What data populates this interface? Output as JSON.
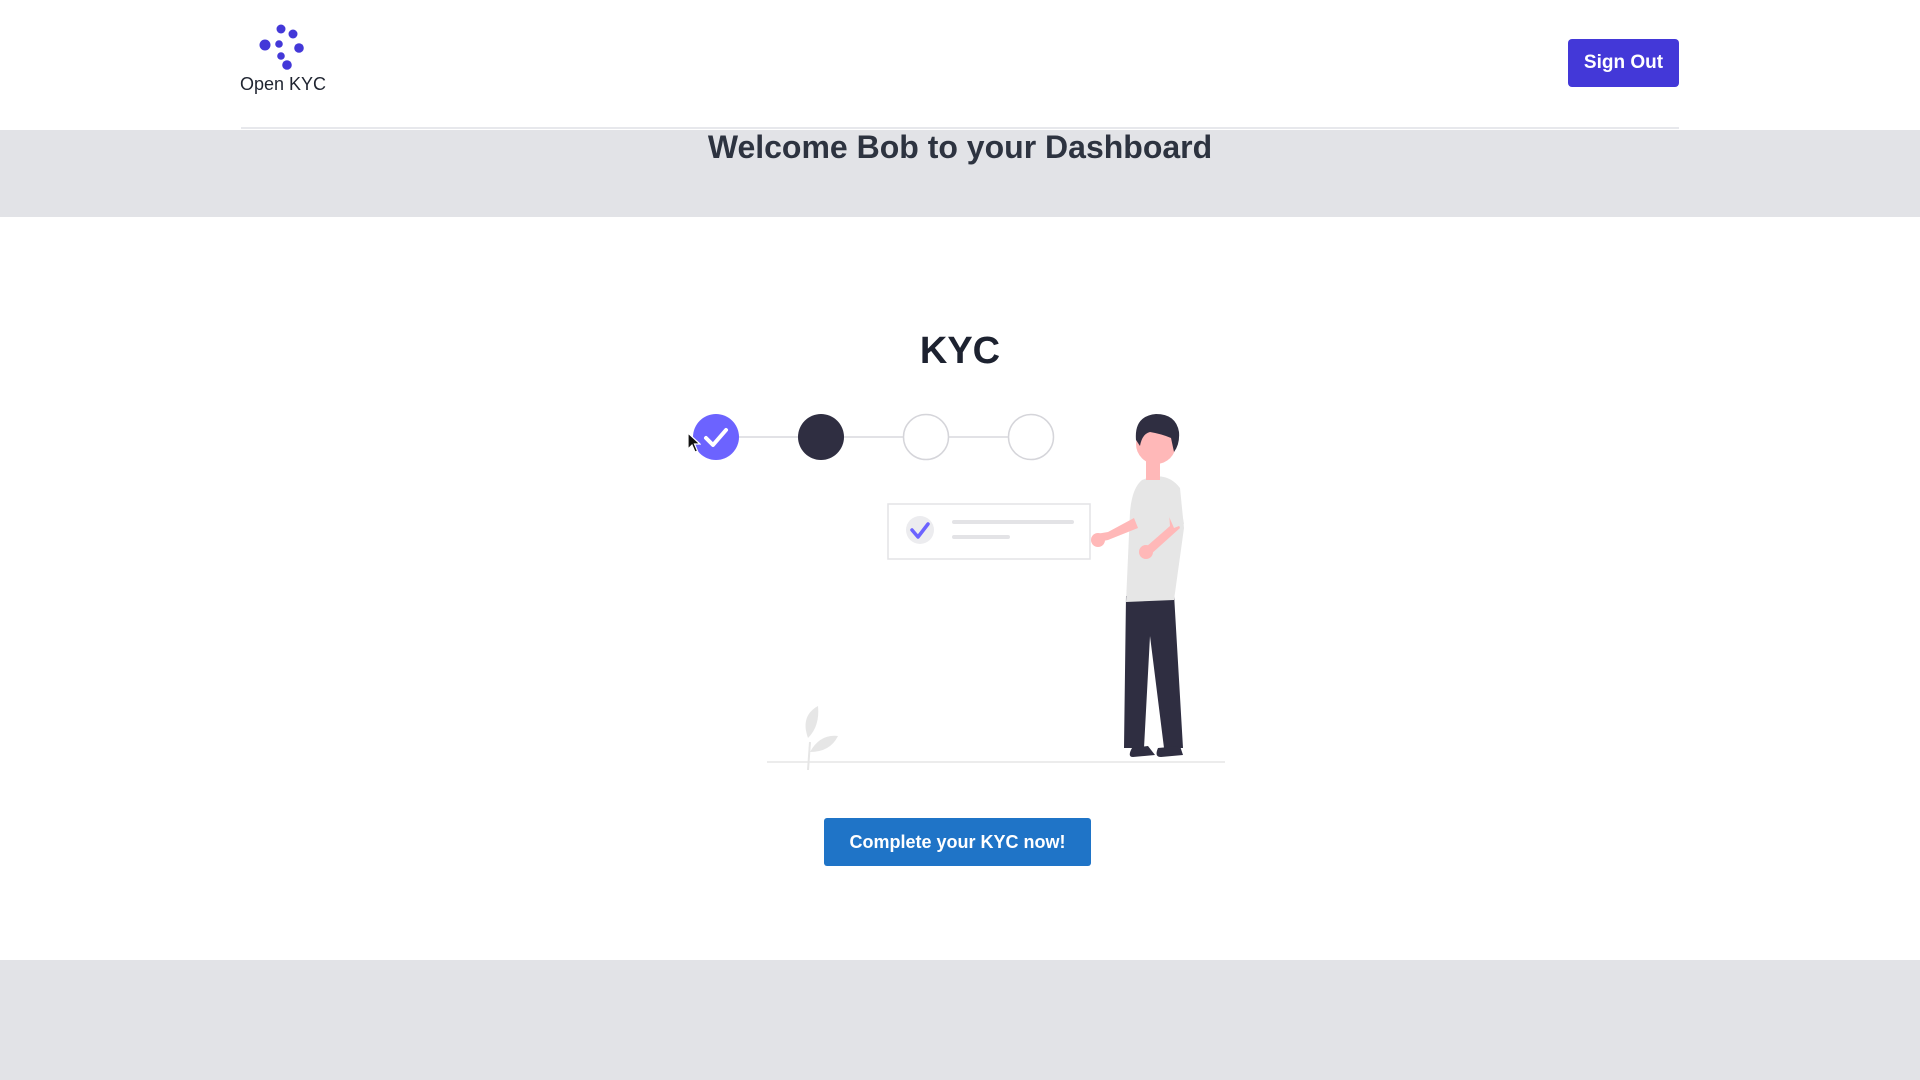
{
  "header": {
    "logo_text": "Open KYC",
    "sign_out_label": "Sign Out"
  },
  "welcome": {
    "title": "Welcome Bob to your Dashboard"
  },
  "kyc": {
    "title": "KYC",
    "steps": [
      {
        "state": "completed"
      },
      {
        "state": "current"
      },
      {
        "state": "pending"
      },
      {
        "state": "pending"
      }
    ],
    "cta_label": "Complete your KYC now!"
  },
  "colors": {
    "brand": "#4338d8",
    "step_completed": "#6c63ff",
    "step_current": "#2f2e41",
    "cta": "#1f74c7",
    "band": "#e2e3e7"
  },
  "icons": {
    "logo": "dots-logo-icon",
    "check": "check-icon",
    "cursor": "mouse-pointer-icon"
  }
}
